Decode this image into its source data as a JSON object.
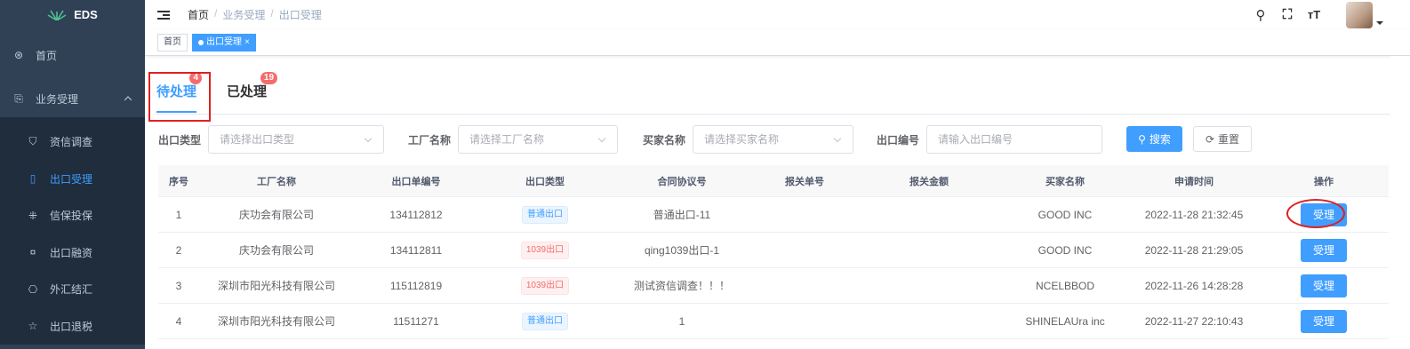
{
  "sidebar": {
    "logo": "EDS",
    "home": "首页",
    "business": "业务受理",
    "items": [
      {
        "label": "资信调查",
        "icon": "shield-icon",
        "glyph": "⛉"
      },
      {
        "label": "出口受理",
        "icon": "book-icon",
        "glyph": "▯"
      },
      {
        "label": "信保投保",
        "icon": "grid-icon",
        "glyph": "⁜"
      },
      {
        "label": "出口融资",
        "icon": "money-icon",
        "glyph": "¤"
      },
      {
        "label": "外汇结汇",
        "icon": "exchange-icon",
        "glyph": "⎔"
      },
      {
        "label": "出口退税",
        "icon": "star-icon",
        "glyph": "☆"
      }
    ]
  },
  "navbar": {
    "breadcrumb": [
      "首页",
      "业务受理",
      "出口受理"
    ]
  },
  "tags": {
    "home": "首页",
    "current": "出口受理",
    "close": "×"
  },
  "tabs": [
    {
      "label": "待处理",
      "badge": "4",
      "active": true
    },
    {
      "label": "已处理",
      "badge": "19",
      "active": false
    }
  ],
  "filters": {
    "export_type_label": "出口类型",
    "export_type_placeholder": "请选择出口类型",
    "factory_label": "工厂名称",
    "factory_placeholder": "请选择工厂名称",
    "buyer_label": "买家名称",
    "buyer_placeholder": "请选择买家名称",
    "export_no_label": "出口编号",
    "export_no_placeholder": "请输入出口编号",
    "search_label": "搜索",
    "reset_label": "重置"
  },
  "table": {
    "columns": [
      "序号",
      "工厂名称",
      "出口单编号",
      "出口类型",
      "合同协议号",
      "报关单号",
      "报关金额",
      "买家名称",
      "申请时间",
      "操作"
    ],
    "rows": [
      {
        "idx": "1",
        "factory": "庆功会有限公司",
        "no": "134112812",
        "type": "普通出口",
        "type_style": "blue",
        "contract": "普通出口-11",
        "customs_no": "",
        "amount": "",
        "buyer": "GOOD INC",
        "time": "2022-11-28 21:32:45",
        "op": "受理"
      },
      {
        "idx": "2",
        "factory": "庆功会有限公司",
        "no": "134112811",
        "type": "1039出口",
        "type_style": "red",
        "contract": "qing1039出口-1",
        "customs_no": "",
        "amount": "",
        "buyer": "GOOD INC",
        "time": "2022-11-28 21:29:05",
        "op": "受理"
      },
      {
        "idx": "3",
        "factory": "深圳市阳光科技有限公司",
        "no": "115112819",
        "type": "1039出口",
        "type_style": "red",
        "contract": "测试资信调查！！！",
        "customs_no": "",
        "amount": "",
        "buyer": "NCELBBOD",
        "time": "2022-11-26 14:28:28",
        "op": "受理"
      },
      {
        "idx": "4",
        "factory": "深圳市阳光科技有限公司",
        "no": "11511271",
        "type": "普通出口",
        "type_style": "blue",
        "contract": "1",
        "customs_no": "",
        "amount": "",
        "buyer": "SHINELAUra inc",
        "time": "2022-11-27 22:10:43",
        "op": "受理"
      }
    ]
  },
  "colors": {
    "accent": "#409eff",
    "sidebar": "#304156",
    "danger": "#f56c6c",
    "highlight": "#e02020"
  }
}
